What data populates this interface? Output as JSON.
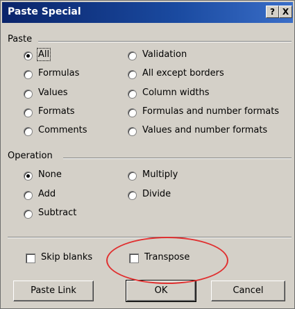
{
  "window": {
    "title": "Paste Special"
  },
  "title_buttons": {
    "help": "?",
    "close": "X"
  },
  "paste": {
    "label": "Paste",
    "options": [
      {
        "label": "All",
        "checked": true
      },
      {
        "label": "Validation",
        "checked": false
      },
      {
        "label": "Formulas",
        "checked": false
      },
      {
        "label": "All except borders",
        "checked": false
      },
      {
        "label": "Values",
        "checked": false
      },
      {
        "label": "Column widths",
        "checked": false
      },
      {
        "label": "Formats",
        "checked": false
      },
      {
        "label": "Formulas and number formats",
        "checked": false
      },
      {
        "label": "Comments",
        "checked": false
      },
      {
        "label": "Values and number formats",
        "checked": false
      }
    ]
  },
  "operation": {
    "label": "Operation",
    "options": [
      {
        "label": "None",
        "checked": true
      },
      {
        "label": "Multiply",
        "checked": false
      },
      {
        "label": "Add",
        "checked": false
      },
      {
        "label": "Divide",
        "checked": false
      },
      {
        "label": "Subtract",
        "checked": false
      }
    ]
  },
  "checkboxes": {
    "skip_blanks": {
      "label": "Skip blanks",
      "checked": false
    },
    "transpose": {
      "label": "Transpose",
      "checked": false
    }
  },
  "buttons": {
    "paste_link": "Paste Link",
    "ok": "OK",
    "cancel": "Cancel"
  },
  "colors": {
    "titlebar": "#0a246a",
    "dialog": "#d4d0c8",
    "annotation": "#e03030"
  }
}
